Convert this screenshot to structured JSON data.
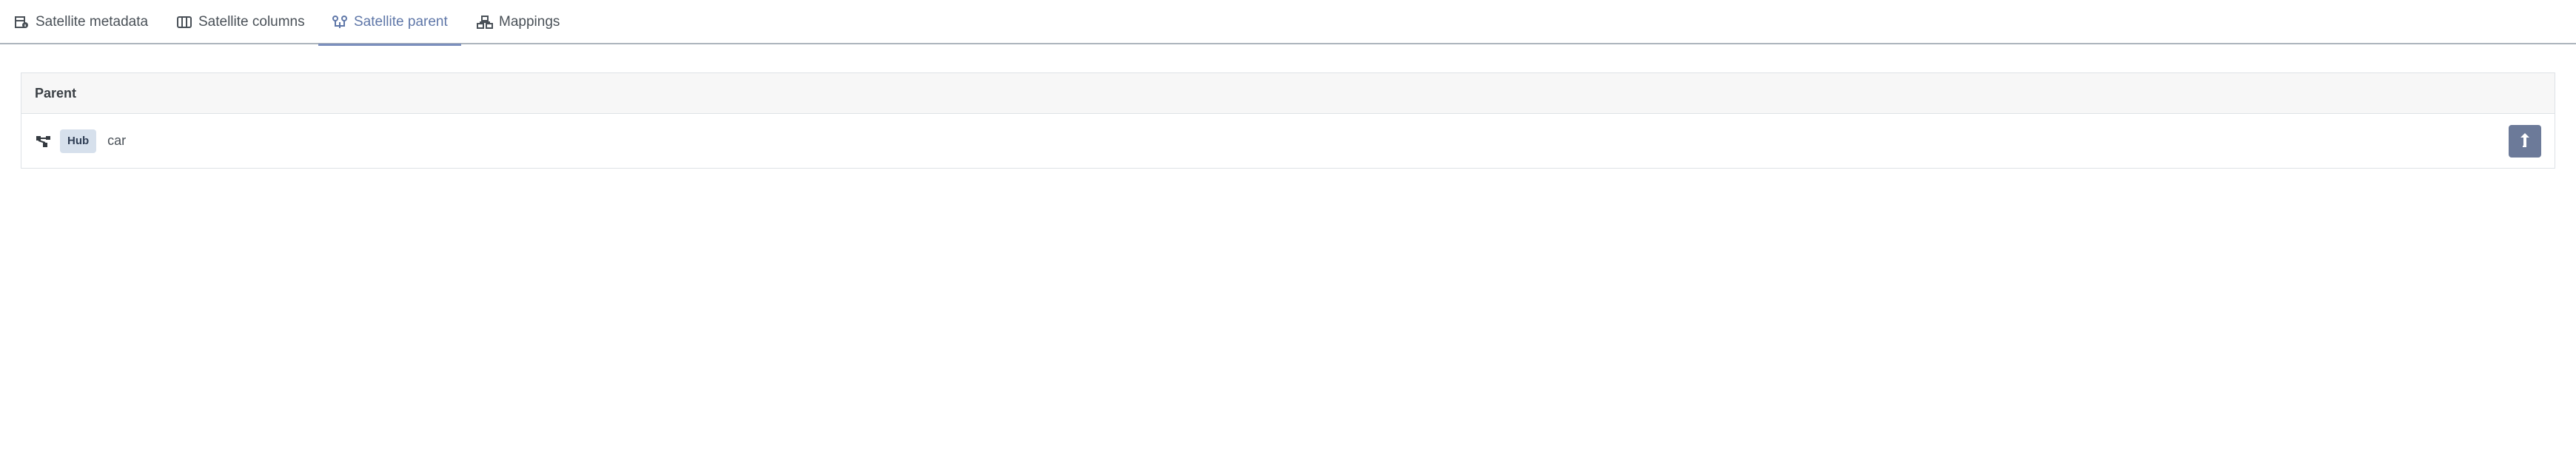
{
  "tabs": [
    {
      "label": "Satellite metadata",
      "icon": "table-info-icon",
      "active": false
    },
    {
      "label": "Satellite columns",
      "icon": "columns-icon",
      "active": false
    },
    {
      "label": "Satellite parent",
      "icon": "parent-link-icon",
      "active": true
    },
    {
      "label": "Mappings",
      "icon": "hierarchy-icon",
      "active": false
    }
  ],
  "panel": {
    "header": "Parent",
    "row": {
      "icon": "hub-network-icon",
      "badge": "Hub",
      "name": "car",
      "action_icon": "navigate-up-icon"
    }
  },
  "colors": {
    "active_tab": "#5f77a8",
    "badge_bg": "#d6e0ec",
    "action_button": "#6c7a99"
  }
}
